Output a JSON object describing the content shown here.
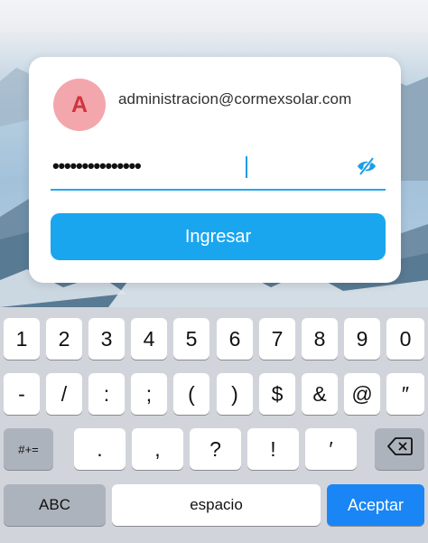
{
  "login": {
    "avatar_initial": "A",
    "email": "administracion@cormexsolar.com",
    "password_masked": "•••••••••••••••",
    "submit_label": "Ingresar"
  },
  "icons": {
    "visibility_toggle": "eye-off-icon",
    "backspace": "backspace-icon"
  },
  "colors": {
    "accent": "#1aa6ef",
    "avatar_bg": "#f4a6ad",
    "avatar_text": "#d0343f",
    "keyboard_accept": "#1a86f5"
  },
  "keyboard": {
    "row1": [
      "1",
      "2",
      "3",
      "4",
      "5",
      "6",
      "7",
      "8",
      "9",
      "0"
    ],
    "row2": [
      "-",
      "/",
      ":",
      ";",
      "(",
      ")",
      "$",
      "&",
      "@",
      "″"
    ],
    "row3": [
      ".",
      ",",
      "?",
      "!",
      "′"
    ],
    "symbols_label": "#+=",
    "abc_label": "ABC",
    "space_label": "espacio",
    "accept_label": "Aceptar"
  }
}
